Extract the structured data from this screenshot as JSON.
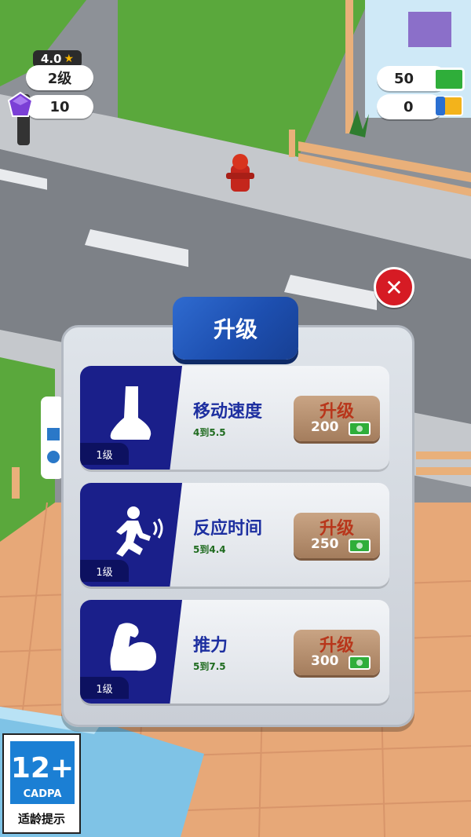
{
  "hud": {
    "rating": "4.0",
    "level": "2级",
    "gems": "10",
    "cash": "50",
    "tickets": "0"
  },
  "panel": {
    "title": "升级",
    "rows": [
      {
        "icon": "foot-icon",
        "name": "移动速度",
        "range": "4到5.5",
        "level": "1级",
        "button": "升级",
        "price": "200"
      },
      {
        "icon": "runner-icon",
        "name": "反应时间",
        "range": "5到4.4",
        "level": "1级",
        "button": "升级",
        "price": "250"
      },
      {
        "icon": "flexed-arm-icon",
        "name": "推力",
        "range": "5到7.5",
        "level": "1级",
        "button": "升级",
        "price": "300"
      }
    ]
  },
  "close_icon": "close-icon",
  "age_rating": {
    "age": "12+",
    "org": "CADPA",
    "tip": "适龄提示"
  },
  "colors": {
    "panel_blue": "#1a1f8a",
    "title_blue": "#1d4fb0",
    "price_btn": "#b08a6a",
    "close_red": "#d61b24"
  }
}
